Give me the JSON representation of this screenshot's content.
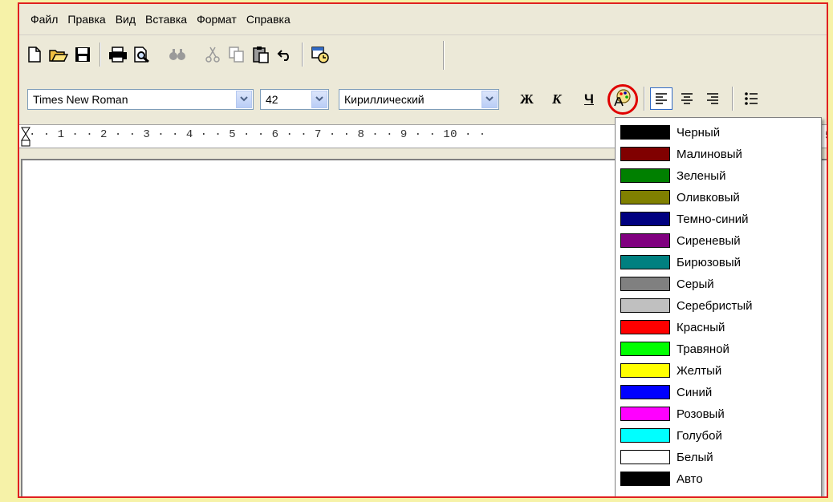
{
  "menu": [
    "Файл",
    "Правка",
    "Вид",
    "Вставка",
    "Формат",
    "Справка"
  ],
  "font": {
    "name": "Times New Roman",
    "size": "42",
    "script": "Кириллический"
  },
  "format_buttons": {
    "bold": "Ж",
    "italic": "К",
    "underline": "Ч"
  },
  "ruler": {
    "text": "·  ·  1  ·  ·  2  ·  ·  3  ·  ·  4  ·  ·  5  ·  ·  6  ·  ·  7  ·  ·  8  ·  ·  9  ·  ·  10  ·  ·",
    "overflow_digit": "5"
  },
  "colors": [
    {
      "label": "Черный",
      "hex": "#000000"
    },
    {
      "label": "Малиновый",
      "hex": "#800000"
    },
    {
      "label": "Зеленый",
      "hex": "#008000"
    },
    {
      "label": "Оливковый",
      "hex": "#808000"
    },
    {
      "label": "Темно-синий",
      "hex": "#000080"
    },
    {
      "label": "Сиреневый",
      "hex": "#800080"
    },
    {
      "label": "Бирюзовый",
      "hex": "#008080"
    },
    {
      "label": "Серый",
      "hex": "#808080"
    },
    {
      "label": "Серебристый",
      "hex": "#c0c0c0"
    },
    {
      "label": "Красный",
      "hex": "#ff0000"
    },
    {
      "label": "Травяной",
      "hex": "#00ff00"
    },
    {
      "label": "Желтый",
      "hex": "#ffff00"
    },
    {
      "label": "Синий",
      "hex": "#0000ff"
    },
    {
      "label": "Розовый",
      "hex": "#ff00ff"
    },
    {
      "label": "Голубой",
      "hex": "#00ffff"
    },
    {
      "label": "Белый",
      "hex": "#ffffff"
    },
    {
      "label": "Авто",
      "hex": "#000000"
    }
  ],
  "icons": [
    "new-file-icon",
    "open-folder-icon",
    "save-icon",
    "print-icon",
    "print-preview-icon",
    "find-icon",
    "cut-icon",
    "copy-icon",
    "paste-icon",
    "undo-icon",
    "date-time-icon",
    "font-color-icon",
    "align-left-icon",
    "align-center-icon",
    "align-right-icon",
    "bullets-icon"
  ]
}
